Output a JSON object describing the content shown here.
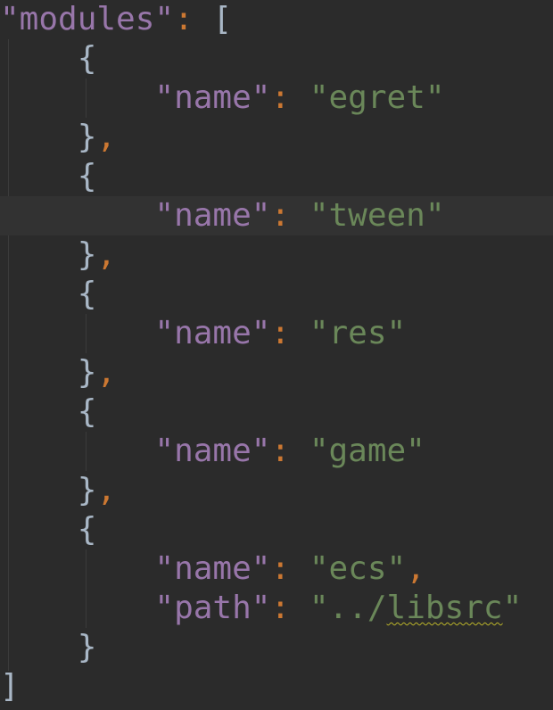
{
  "editor": {
    "colors": {
      "background": "#2b2b2b",
      "current_line": "#323232",
      "key": "#9876aa",
      "string": "#6a8759",
      "punctuation": "#cc7832",
      "bracket": "#a9b7c6",
      "indent_guide": "#3b3b3b",
      "spell_squiggle": "#bbb529"
    },
    "lines": [
      {
        "tokens": [
          {
            "t": "key",
            "v": "\"modules\""
          },
          {
            "t": "punct",
            "v": ":"
          },
          {
            "t": "plain",
            "v": " "
          },
          {
            "t": "bracket",
            "v": "["
          }
        ]
      },
      {
        "tokens": [
          {
            "t": "plain",
            "v": "    "
          },
          {
            "t": "bracket",
            "v": "{"
          }
        ]
      },
      {
        "tokens": [
          {
            "t": "plain",
            "v": "        "
          },
          {
            "t": "key",
            "v": "\"name\""
          },
          {
            "t": "punct",
            "v": ":"
          },
          {
            "t": "plain",
            "v": " "
          },
          {
            "t": "str",
            "v": "\"egret\""
          }
        ]
      },
      {
        "tokens": [
          {
            "t": "plain",
            "v": "    "
          },
          {
            "t": "bracket",
            "v": "}"
          },
          {
            "t": "punct",
            "v": ","
          }
        ]
      },
      {
        "tokens": [
          {
            "t": "plain",
            "v": "    "
          },
          {
            "t": "bracket",
            "v": "{"
          }
        ]
      },
      {
        "current": true,
        "tokens": [
          {
            "t": "plain",
            "v": "        "
          },
          {
            "t": "key",
            "v": "\"name\""
          },
          {
            "t": "punct",
            "v": ":"
          },
          {
            "t": "plain",
            "v": " "
          },
          {
            "t": "str",
            "v": "\"tween\""
          }
        ]
      },
      {
        "tokens": [
          {
            "t": "plain",
            "v": "    "
          },
          {
            "t": "bracket",
            "v": "}"
          },
          {
            "t": "punct",
            "v": ","
          }
        ]
      },
      {
        "tokens": [
          {
            "t": "plain",
            "v": "    "
          },
          {
            "t": "bracket",
            "v": "{"
          }
        ]
      },
      {
        "tokens": [
          {
            "t": "plain",
            "v": "        "
          },
          {
            "t": "key",
            "v": "\"name\""
          },
          {
            "t": "punct",
            "v": ":"
          },
          {
            "t": "plain",
            "v": " "
          },
          {
            "t": "str",
            "v": "\"res\""
          }
        ]
      },
      {
        "tokens": [
          {
            "t": "plain",
            "v": "    "
          },
          {
            "t": "bracket",
            "v": "}"
          },
          {
            "t": "punct",
            "v": ","
          }
        ]
      },
      {
        "tokens": [
          {
            "t": "plain",
            "v": "    "
          },
          {
            "t": "bracket",
            "v": "{"
          }
        ]
      },
      {
        "tokens": [
          {
            "t": "plain",
            "v": "        "
          },
          {
            "t": "key",
            "v": "\"name\""
          },
          {
            "t": "punct",
            "v": ":"
          },
          {
            "t": "plain",
            "v": " "
          },
          {
            "t": "str",
            "v": "\"game\""
          }
        ]
      },
      {
        "tokens": [
          {
            "t": "plain",
            "v": "    "
          },
          {
            "t": "bracket",
            "v": "}"
          },
          {
            "t": "punct",
            "v": ","
          }
        ]
      },
      {
        "tokens": [
          {
            "t": "plain",
            "v": "    "
          },
          {
            "t": "bracket",
            "v": "{"
          }
        ]
      },
      {
        "tokens": [
          {
            "t": "plain",
            "v": "        "
          },
          {
            "t": "key",
            "v": "\"name\""
          },
          {
            "t": "punct",
            "v": ":"
          },
          {
            "t": "plain",
            "v": " "
          },
          {
            "t": "str",
            "v": "\"ecs\""
          },
          {
            "t": "punct",
            "v": ","
          }
        ]
      },
      {
        "tokens": [
          {
            "t": "plain",
            "v": "        "
          },
          {
            "t": "key",
            "v": "\"path\""
          },
          {
            "t": "punct",
            "v": ":"
          },
          {
            "t": "plain",
            "v": " "
          },
          {
            "t": "str",
            "v": "\"../"
          },
          {
            "t": "str",
            "v": "libsrc",
            "squiggle": true
          },
          {
            "t": "str",
            "v": "\""
          }
        ]
      },
      {
        "tokens": [
          {
            "t": "plain",
            "v": "    "
          },
          {
            "t": "bracket",
            "v": "}"
          }
        ]
      },
      {
        "tokens": [
          {
            "t": "bracket",
            "v": "]"
          }
        ]
      }
    ]
  }
}
